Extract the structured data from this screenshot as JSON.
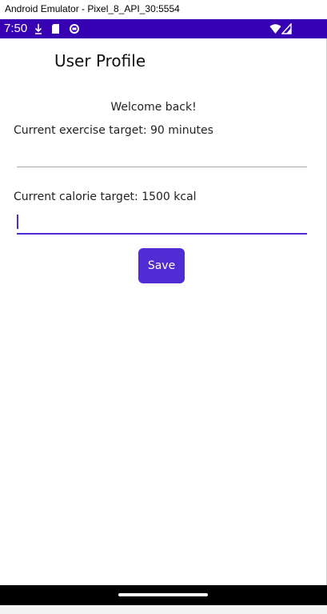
{
  "window": {
    "title": "Android Emulator - Pixel_8_API_30:5554"
  },
  "status_bar": {
    "time": "7:50",
    "icons": [
      "download-icon",
      "sd-card-icon",
      "sync-icon",
      "wifi-icon",
      "signal-icon"
    ]
  },
  "page": {
    "title": "User Profile",
    "welcome": "Welcome back!",
    "exercise_label": "Current exercise target: 90 minutes",
    "exercise_value": "",
    "calorie_label": "Current calorie target: 1500 kcal",
    "calorie_value": "",
    "save_label": "Save"
  },
  "colors": {
    "status_bar": "#3700b3",
    "accent": "#512bd4",
    "nav_bar": "#000000"
  }
}
